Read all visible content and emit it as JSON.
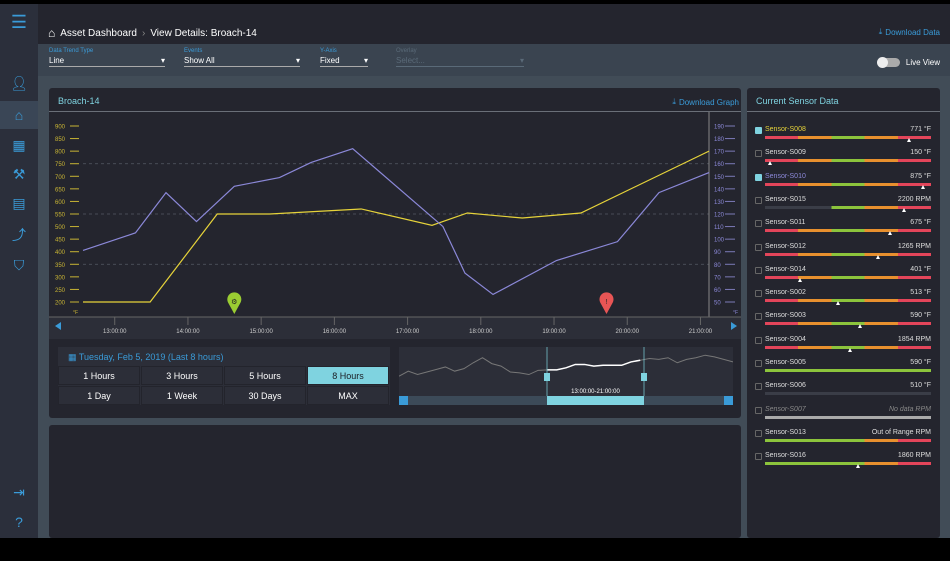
{
  "header": {
    "breadcrumb_root": "Asset Dashboard",
    "breadcrumb_current": "View Details: Broach-14",
    "download_data": "Download Data"
  },
  "filters": {
    "trend": {
      "label": "Data Trend Type",
      "value": "Line"
    },
    "events": {
      "label": "Events",
      "value": "Show All"
    },
    "yaxis": {
      "label": "Y-Axis",
      "value": "Fixed"
    },
    "overlay": {
      "label": "Overlay",
      "placeholder": "Select..."
    },
    "live_view": "Live View",
    "live_view_on": false
  },
  "chart_panel": {
    "title": "Broach-14",
    "download_graph": "Download Graph"
  },
  "chart_data": {
    "type": "line",
    "x_range": [
      "12:34",
      "21:07"
    ],
    "x_ticks": [
      "13:00:00",
      "14:00:00",
      "15:00:00",
      "16:00:00",
      "17:00:00",
      "18:00:00",
      "19:00:00",
      "20:00:00",
      "21:00:00"
    ],
    "y_left": {
      "unit": "°F",
      "ylim": [
        200,
        900
      ],
      "ticks": [
        900,
        850,
        800,
        750,
        700,
        650,
        600,
        550,
        500,
        450,
        400,
        350,
        300,
        250,
        200
      ]
    },
    "y_right": {
      "unit": "°F",
      "ylim": [
        50,
        190
      ],
      "ticks": [
        190,
        180,
        170,
        160,
        150,
        140,
        130,
        120,
        110,
        100,
        90,
        80,
        70,
        60,
        50
      ]
    },
    "grid": "dashed at 750, 550, 350",
    "series": [
      {
        "color": "#e6d33a",
        "axis": "left",
        "points": [
          [
            "12:34",
            200
          ],
          [
            "13:29",
            200
          ],
          [
            "14:24",
            550
          ],
          [
            "15:07",
            550
          ],
          [
            "16:22",
            570
          ],
          [
            "17:20",
            505
          ],
          [
            "17:49",
            554
          ],
          [
            "18:34",
            534
          ],
          [
            "19:22",
            554
          ],
          [
            "21:07",
            800
          ]
        ]
      },
      {
        "color": "#8b88d8",
        "axis": "right",
        "points": [
          [
            "12:34",
            91
          ],
          [
            "13:17",
            105
          ],
          [
            "13:42",
            137
          ],
          [
            "14:07",
            114
          ],
          [
            "14:38",
            142
          ],
          [
            "15:15",
            149
          ],
          [
            "15:41",
            161
          ],
          [
            "16:15",
            172
          ],
          [
            "17:29",
            110
          ],
          [
            "17:47",
            73
          ],
          [
            "18:10",
            56
          ],
          [
            "19:02",
            83
          ],
          [
            "19:52",
            98
          ],
          [
            "20:26",
            137
          ],
          [
            "21:07",
            153
          ]
        ]
      }
    ],
    "events": [
      {
        "time": "14:38",
        "type": "maintenance",
        "color": "#9acd32"
      },
      {
        "time": "19:43",
        "type": "warning",
        "color": "#e85555"
      }
    ]
  },
  "range": {
    "date": "Tuesday, Feb 5, 2019 (Last 8 hours)",
    "buttons": [
      "1 Hours",
      "3 Hours",
      "5 Hours",
      "8 Hours",
      "1 Day",
      "1 Week",
      "30 Days",
      "MAX"
    ],
    "selected": "8 Hours"
  },
  "overview": {
    "window_label": "13:00:00-21:00:00",
    "values": [
      40,
      52,
      44,
      50,
      56,
      62,
      52,
      58,
      72,
      84,
      70,
      64,
      50,
      48,
      44,
      54,
      55,
      55,
      60,
      68,
      68,
      64,
      66,
      66,
      66,
      74,
      78,
      82,
      80,
      84,
      72,
      80,
      84,
      90,
      86,
      80,
      74
    ]
  },
  "sensor_panel": {
    "title": "Current Sensor Data",
    "sensors": [
      {
        "name": "Sensor-S008",
        "value": "771 °F",
        "checked": true,
        "color": "#e6d33a",
        "bar": "std",
        "marker": 0.87
      },
      {
        "name": "Sensor-S009",
        "value": "150 °F",
        "checked": false,
        "bar": "std",
        "marker": 0.03
      },
      {
        "name": "Sensor-S010",
        "value": "875 °F",
        "checked": true,
        "color": "#8b88d8",
        "bar": "std",
        "marker": 0.95
      },
      {
        "name": "Sensor-S015",
        "value": "2200 RPM",
        "checked": false,
        "bar": "partial",
        "marker": 0.84
      },
      {
        "name": "Sensor-S011",
        "value": "675 °F",
        "checked": false,
        "bar": "std",
        "marker": 0.75
      },
      {
        "name": "Sensor-S012",
        "value": "1265 RPM",
        "checked": false,
        "bar": "std",
        "marker": 0.68
      },
      {
        "name": "Sensor-S014",
        "value": "401 °F",
        "checked": false,
        "bar": "std",
        "marker": 0.21
      },
      {
        "name": "Sensor-S002",
        "value": "513 °F",
        "checked": false,
        "bar": "std",
        "marker": 0.44
      },
      {
        "name": "Sensor-S003",
        "value": "590 °F",
        "checked": false,
        "bar": "std",
        "marker": 0.57
      },
      {
        "name": "Sensor-S004",
        "value": "1854 RPM",
        "checked": false,
        "bar": "std",
        "marker": 0.51
      },
      {
        "name": "Sensor-S005",
        "value": "590 °F",
        "checked": false,
        "bar": "green"
      },
      {
        "name": "Sensor-S006",
        "value": "510 °F",
        "checked": false,
        "bar": "empty"
      },
      {
        "name": "Sensor-S007",
        "value": "No data  RPM",
        "checked": false,
        "bar": "nodata",
        "dim": true
      },
      {
        "name": "Sensor-S013",
        "value": "Out of Range  RPM",
        "checked": false,
        "bar": "high"
      },
      {
        "name": "Sensor-S016",
        "value": "1860 RPM",
        "checked": false,
        "bar": "high",
        "marker": 0.56
      }
    ]
  }
}
